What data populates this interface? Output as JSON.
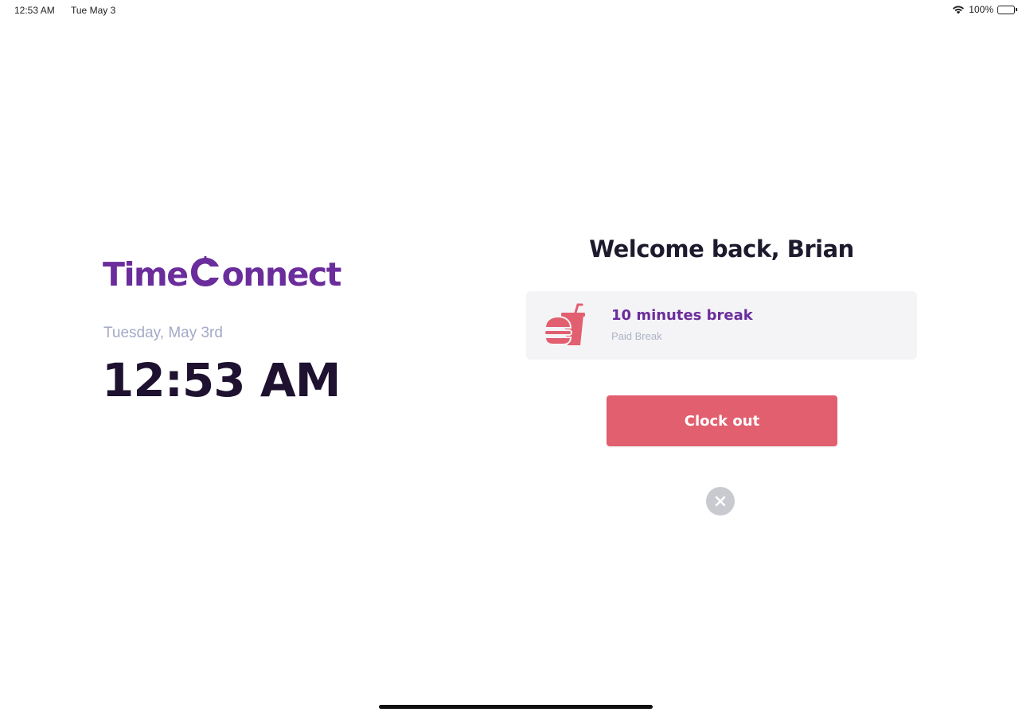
{
  "status_bar": {
    "time": "12:53 AM",
    "date": "Tue May 3",
    "battery": "100%",
    "icons": [
      "wifi-icon",
      "battery-icon"
    ]
  },
  "brand": {
    "name_part1": "Time",
    "name_part2": "onnect",
    "color": "#6b2d9b"
  },
  "clock": {
    "date": "Tuesday, May 3rd",
    "time": "12:53 AM"
  },
  "welcome": {
    "message": "Welcome back, Brian"
  },
  "break_card": {
    "title": "10 minutes break",
    "subtitle": "Paid Break",
    "icon": "food-drink-icon"
  },
  "actions": {
    "clock_out_label": "Clock out",
    "close_icon": "close-icon"
  },
  "colors": {
    "accent": "#e25f6f",
    "brand": "#6b2d9b",
    "text_dark": "#1e1230",
    "text_muted": "#a4a9c6",
    "card_bg": "#f4f4f6"
  }
}
